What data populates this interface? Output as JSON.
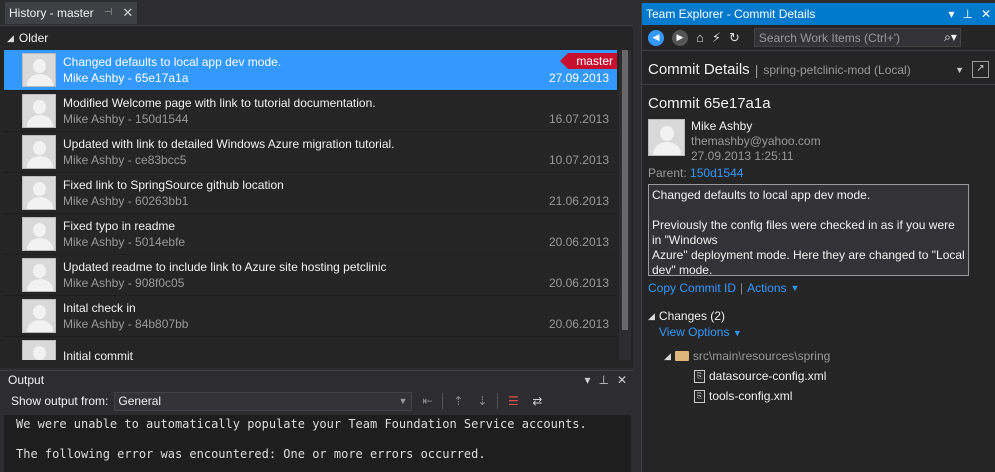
{
  "history": {
    "tab_title": "History - master",
    "pin_glyph": "⊣",
    "close_glyph": "✕",
    "group_label": "Older",
    "commits": [
      {
        "message": "Changed defaults to local app dev mode.",
        "meta": "Mike Ashby - 65e17a1a",
        "date": "27.09.2013",
        "branch": "master",
        "selected": true
      },
      {
        "message": "Modified Welcome page with link to tutorial documentation.",
        "meta": "Mike Ashby - 150d1544",
        "date": "16.07.2013"
      },
      {
        "message": "Updated with link to detailed Windows Azure migration tutorial.",
        "meta": "Mike Ashby - ce83bcc5",
        "date": "10.07.2013"
      },
      {
        "message": "Fixed link to SpringSource github location",
        "meta": "Mike Ashby - 60263bb1",
        "date": "21.06.2013"
      },
      {
        "message": "Fixed typo in readme",
        "meta": "Mike Ashby - 5014ebfe",
        "date": "20.06.2013"
      },
      {
        "message": "Updated readme to include link to Azure site hosting petclinic",
        "meta": "Mike Ashby - 908f0c05",
        "date": "20.06.2013"
      },
      {
        "message": "Inital check in",
        "meta": "Mike Ashby - 84b807bb",
        "date": "20.06.2013"
      },
      {
        "message": "Initial commit",
        "meta": "",
        "date": ""
      }
    ]
  },
  "output": {
    "title": "Output",
    "show_from_label": "Show output from:",
    "source": "General",
    "lines": "We were unable to automatically populate your Team Foundation Service accounts.\n\nThe following error was encountered: One or more errors occurred."
  },
  "team_explorer": {
    "title": "Team Explorer - Commit Details",
    "search_placeholder": "Search Work Items (Ctrl+')",
    "page_title": "Commit Details",
    "context": "spring-petclinic-mod (Local)",
    "commit_id": "Commit 65e17a1a",
    "author_name": "Mike Ashby",
    "author_email": "themashby@yahoo.com",
    "author_date": "27.09.2013 1:25:11",
    "parent_label": "Parent:",
    "parent_id": "150d1544",
    "message": "Changed defaults to local app dev mode.\n\nPreviously the config files were checked in as if you were in \"Windows\nAzure\" deployment mode. Here they are changed to \"Local\ndev\" mode.",
    "copy_commit_id": "Copy Commit ID",
    "actions": "Actions",
    "changes_label": "Changes (2)",
    "view_options": "View Options",
    "folder": "src\\main\\resources\\spring",
    "files": [
      "datasource-config.xml",
      "tools-config.xml"
    ]
  }
}
